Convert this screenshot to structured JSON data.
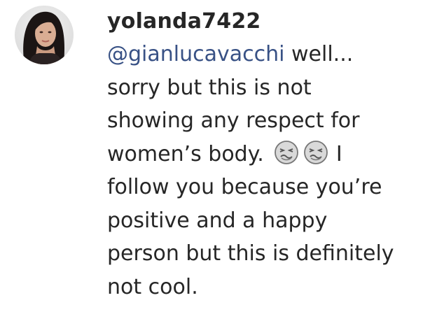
{
  "comment": {
    "username": "yolanda7422",
    "mention": "@gianlucavacchi",
    "line1_rest": " well...",
    "line2": "sorry but this is not",
    "line3": "showing any respect for",
    "line4_start": "women’s body. ",
    "emojis": [
      "nauseated-face-icon",
      "nauseated-face-icon"
    ],
    "line4_end": " I",
    "line5": "follow you because you’re",
    "line6": "positive and a happy",
    "line7": "person but this is definitely",
    "line8": "not cool.",
    "mention_color": "#385185",
    "text_color": "#262626"
  }
}
